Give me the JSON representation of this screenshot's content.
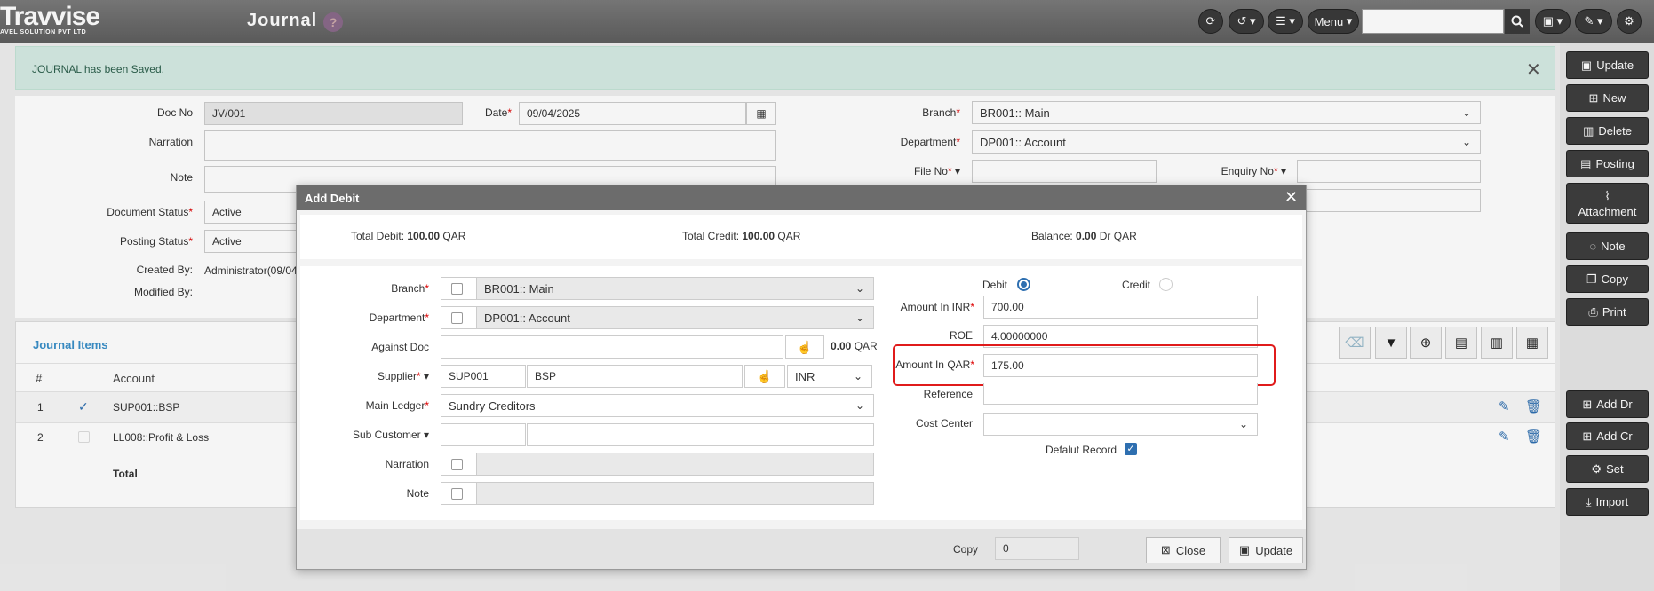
{
  "app": {
    "logo": "Travvise",
    "logo_sub": "AVEL SOLUTION PVT LTD",
    "title": "Journal",
    "help": "?"
  },
  "topbar": {
    "menu_label": "Menu",
    "search_placeholder": ""
  },
  "alert": {
    "message": "JOURNAL has been Saved."
  },
  "form": {
    "doc_no_label": "Doc No",
    "doc_no": "JV/001",
    "date_label": "Date",
    "date": "09/04/2025",
    "narration_label": "Narration",
    "note_label": "Note",
    "doc_status_label": "Document Status",
    "doc_status": "Active",
    "posting_status_label": "Posting Status",
    "posting_status": "Active",
    "created_by_label": "Created By:",
    "created_by": "Administrator(09/04",
    "modified_by_label": "Modified By:",
    "branch_label": "Branch",
    "branch": "BR001:: Main",
    "department_label": "Department",
    "department": "DP001:: Account",
    "file_no_label": "File No",
    "enquiry_no_label": "Enquiry No"
  },
  "items": {
    "title": "Journal Items",
    "columns": [
      "#",
      "Account"
    ],
    "rows": [
      {
        "no": "1",
        "account": "SUP001::BSP",
        "checked": true
      },
      {
        "no": "2",
        "account": "LL008::Profit & Loss",
        "checked": false
      }
    ],
    "total_label": "Total"
  },
  "sidebar": {
    "buttons": [
      "Update",
      "New",
      "Delete",
      "Posting",
      "Attachment",
      "Note",
      "Copy",
      "Print"
    ],
    "lower_buttons": [
      "Add Dr",
      "Add Cr",
      "Set",
      "Import"
    ]
  },
  "modal": {
    "title": "Add Debit",
    "total_debit_label": "Total Debit:",
    "total_debit": "100.00",
    "total_debit_cur": "QAR",
    "total_credit_label": "Total Credit:",
    "total_credit": "100.00",
    "total_credit_cur": "QAR",
    "balance_label": "Balance:",
    "balance": "0.00",
    "balance_suffix": "Dr QAR",
    "branch_label": "Branch",
    "branch": "BR001:: Main",
    "department_label": "Department",
    "department": "DP001:: Account",
    "against_doc_label": "Against Doc",
    "against_amount": "0.00",
    "against_cur": "QAR",
    "supplier_label": "Supplier",
    "supplier_code": "SUP001",
    "supplier_name": "BSP",
    "supplier_cur": "INR",
    "main_ledger_label": "Main Ledger",
    "main_ledger": "Sundry Creditors",
    "sub_customer_label": "Sub Customer",
    "narration_label": "Narration",
    "note_label": "Note",
    "debit_label": "Debit",
    "credit_label": "Credit",
    "amount_inr_label": "Amount In INR",
    "amount_inr": "700.00",
    "roe_label": "ROE",
    "roe": "4.00000000",
    "amount_qar_label": "Amount In QAR",
    "amount_qar": "175.00",
    "reference_label": "Reference",
    "cost_center_label": "Cost Center",
    "default_record_label": "Defalut Record",
    "copy_label": "Copy",
    "copy_value": "0",
    "close_label": "Close",
    "update_label": "Update"
  }
}
